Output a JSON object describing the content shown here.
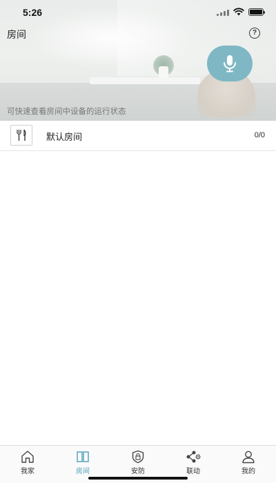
{
  "status_bar": {
    "time": "5:26"
  },
  "header": {
    "title": "房间",
    "help_icon": "question-circle-icon",
    "help_symbol": "?",
    "mic_icon": "microphone-icon",
    "subtitle": "可快速查看房间中设备的运行状态"
  },
  "rooms": [
    {
      "icon": "fork-knife-icon",
      "name": "默认房间",
      "count": "0/0"
    }
  ],
  "tab_bar": {
    "active_index": 1,
    "tabs": [
      {
        "label": "我家",
        "icon": "home-icon"
      },
      {
        "label": "房间",
        "icon": "room-icon"
      },
      {
        "label": "安防",
        "icon": "shield-lock-icon"
      },
      {
        "label": "联动",
        "icon": "share-link-icon"
      },
      {
        "label": "我的",
        "icon": "user-icon"
      }
    ]
  },
  "colors": {
    "accent": "#4aa0b5",
    "mic_button": "#7fb8c4"
  }
}
